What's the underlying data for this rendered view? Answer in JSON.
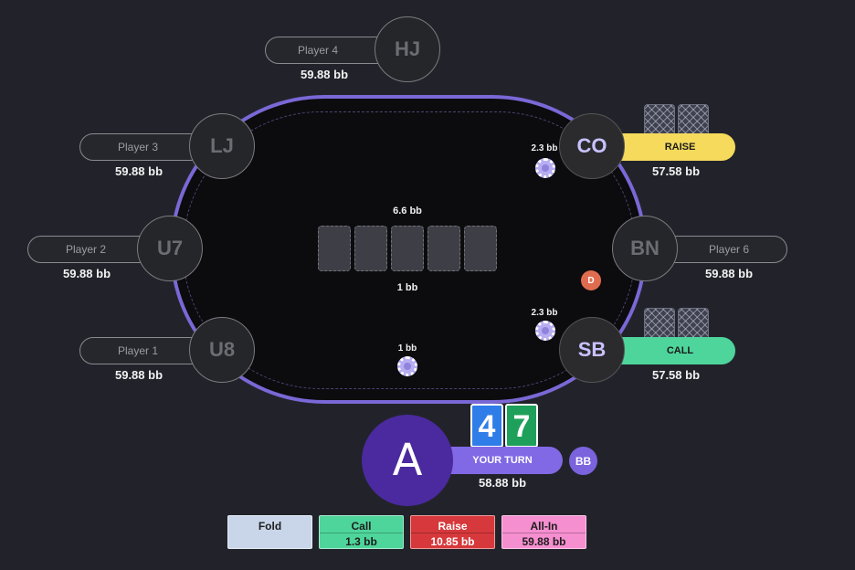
{
  "pot": {
    "total": "6.6 bb",
    "bottom": "1 bb"
  },
  "seats": {
    "hj": {
      "position": "HJ",
      "name": "Player 4",
      "stack": "59.88 bb"
    },
    "lj": {
      "position": "LJ",
      "name": "Player 3",
      "stack": "59.88 bb"
    },
    "u7": {
      "position": "U7",
      "name": "Player 2",
      "stack": "59.88 bb"
    },
    "u8": {
      "position": "U8",
      "name": "Player 1",
      "stack": "59.88 bb"
    },
    "co": {
      "position": "CO",
      "action": "RAISE",
      "stack": "57.58 bb",
      "bet": "2.3 bb",
      "action_color": "#f5da5c"
    },
    "bn": {
      "position": "BN",
      "name": "Player 6",
      "stack": "59.88 bb"
    },
    "sb": {
      "position": "SB",
      "action": "CALL",
      "stack": "57.58 bb",
      "bet": "2.3 bb",
      "action_color": "#4ed59b"
    }
  },
  "hero": {
    "avatar": "A",
    "cards": [
      {
        "rank": "4",
        "color": "#2f7de8"
      },
      {
        "rank": "7",
        "color": "#1ea05a"
      }
    ],
    "status": "YOUR TURN",
    "stack": "58.88 bb",
    "position": "BB",
    "bet": "1 bb"
  },
  "dealer": "D",
  "actions": [
    {
      "label": "Fold",
      "amount": "",
      "color": "#c9d6ea"
    },
    {
      "label": "Call",
      "amount": "1.3 bb",
      "color": "#4ed59b"
    },
    {
      "label": "Raise",
      "amount": "10.85 bb",
      "color": "#d6383b"
    },
    {
      "label": "All-In",
      "amount": "59.88 bb",
      "color": "#f58fd0"
    }
  ]
}
